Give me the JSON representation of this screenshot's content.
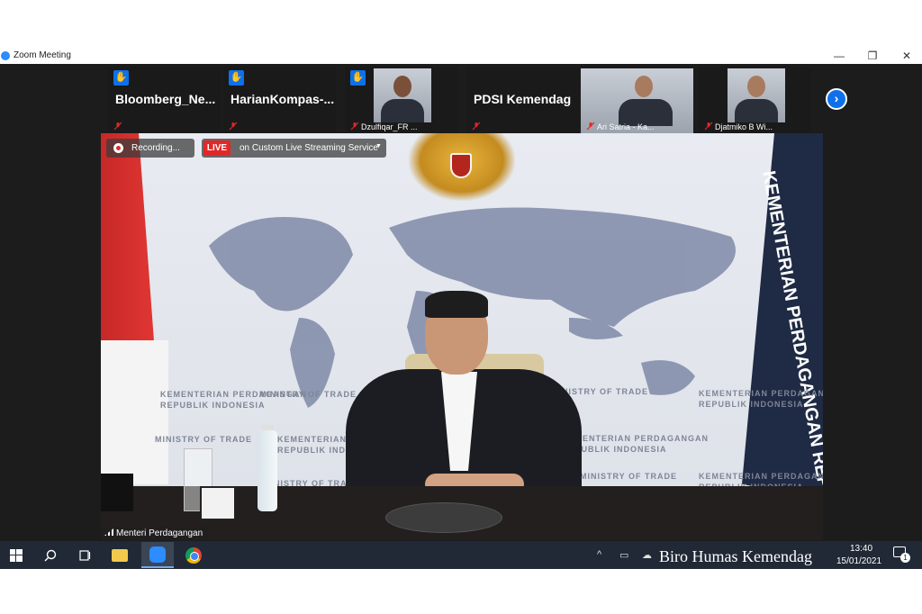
{
  "window": {
    "title": "Zoom Meeting",
    "controls": {
      "minimize": "—",
      "restore": "❐",
      "close": "✕"
    }
  },
  "thumbnails": [
    {
      "label": "Bloomberg_Ne...",
      "type": "name",
      "raised_hand": true,
      "muted": true
    },
    {
      "label": "HarianKompas-...",
      "type": "name",
      "raised_hand": true,
      "muted": true
    },
    {
      "label": "Dzulfiqar_FR ...",
      "type": "video",
      "raised_hand": true,
      "muted": true
    },
    {
      "label": "PDSI Kemendag",
      "type": "name",
      "raised_hand": false,
      "muted": true
    },
    {
      "label": "Ari Satria - Ka...",
      "type": "video",
      "raised_hand": false,
      "muted": true
    },
    {
      "label": "Djatmiko B Wi...",
      "type": "video",
      "raised_hand": false,
      "muted": true
    }
  ],
  "thumbnail_nav_icon": "chevron-right-icon",
  "recording": {
    "label": "Recording..."
  },
  "live": {
    "badge": "LIVE",
    "label": "on Custom Live Streaming Service"
  },
  "active_speaker": {
    "name": "Menteri Perdagangan"
  },
  "wall": {
    "ministry_text": "MINISTRY OF TRADE",
    "kementerian_line1": "KEMENTERIAN PERDAGANGAN",
    "kementerian_line2": "REPUBLIK INDONESIA",
    "banner_text": "KEMENTERIAN PERDAGANGAN REPUBLIK"
  },
  "taskbar": {
    "apps": [
      "windows-start-icon",
      "search-icon",
      "task-view-icon",
      "file-explorer-icon",
      "zoom-icon",
      "chrome-icon"
    ],
    "clock": {
      "time": "13:40",
      "date": "15/01/2021"
    },
    "notification_count": "1"
  },
  "watermark": "Biro Humas Kemendag"
}
